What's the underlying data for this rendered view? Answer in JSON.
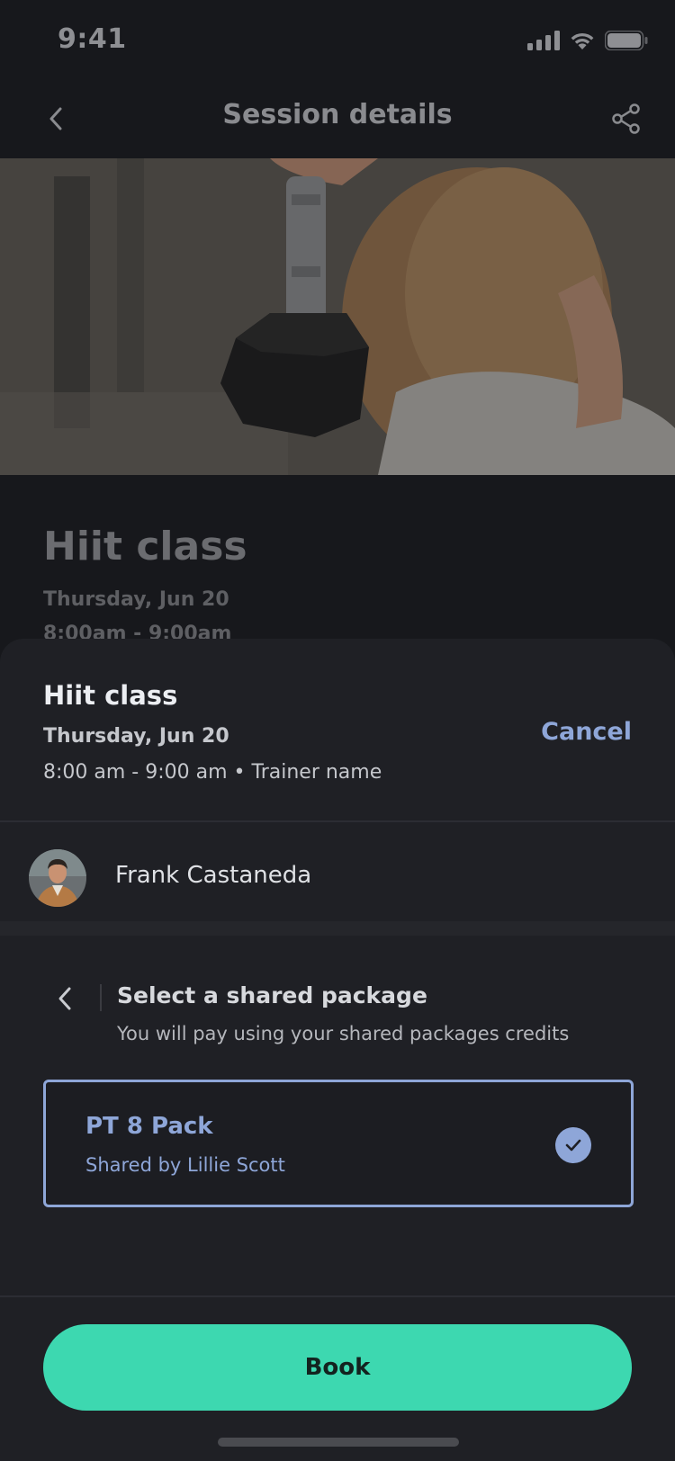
{
  "status_bar": {
    "time": "9:41"
  },
  "nav": {
    "title": "Session details"
  },
  "background_session": {
    "title": "Hiit class",
    "date": "Thursday, Jun 20",
    "time": "8:00am - 9:00am"
  },
  "sheet": {
    "session_title": "Hiit class",
    "session_date": "Thursday, Jun 20",
    "session_time_trainer": "8:00 am - 9:00 am • Trainer name",
    "cancel_label": "Cancel",
    "attendee_name": "Frank Castaneda",
    "package_section_title": "Select a shared package",
    "package_section_subtitle": "You will pay using your shared packages credits",
    "selected_package": {
      "name": "PT 8 Pack",
      "shared_by": "Shared by Lillie Scott",
      "selected": true
    },
    "book_label": "Book"
  },
  "colors": {
    "accent": "#8ea6d8",
    "primary_button": "#3dd8b0",
    "sheet_background": "#1f2025"
  },
  "icons": [
    "chevron-left-icon",
    "share-icon",
    "signal-icon",
    "wifi-icon",
    "battery-icon",
    "checkmark-icon"
  ]
}
